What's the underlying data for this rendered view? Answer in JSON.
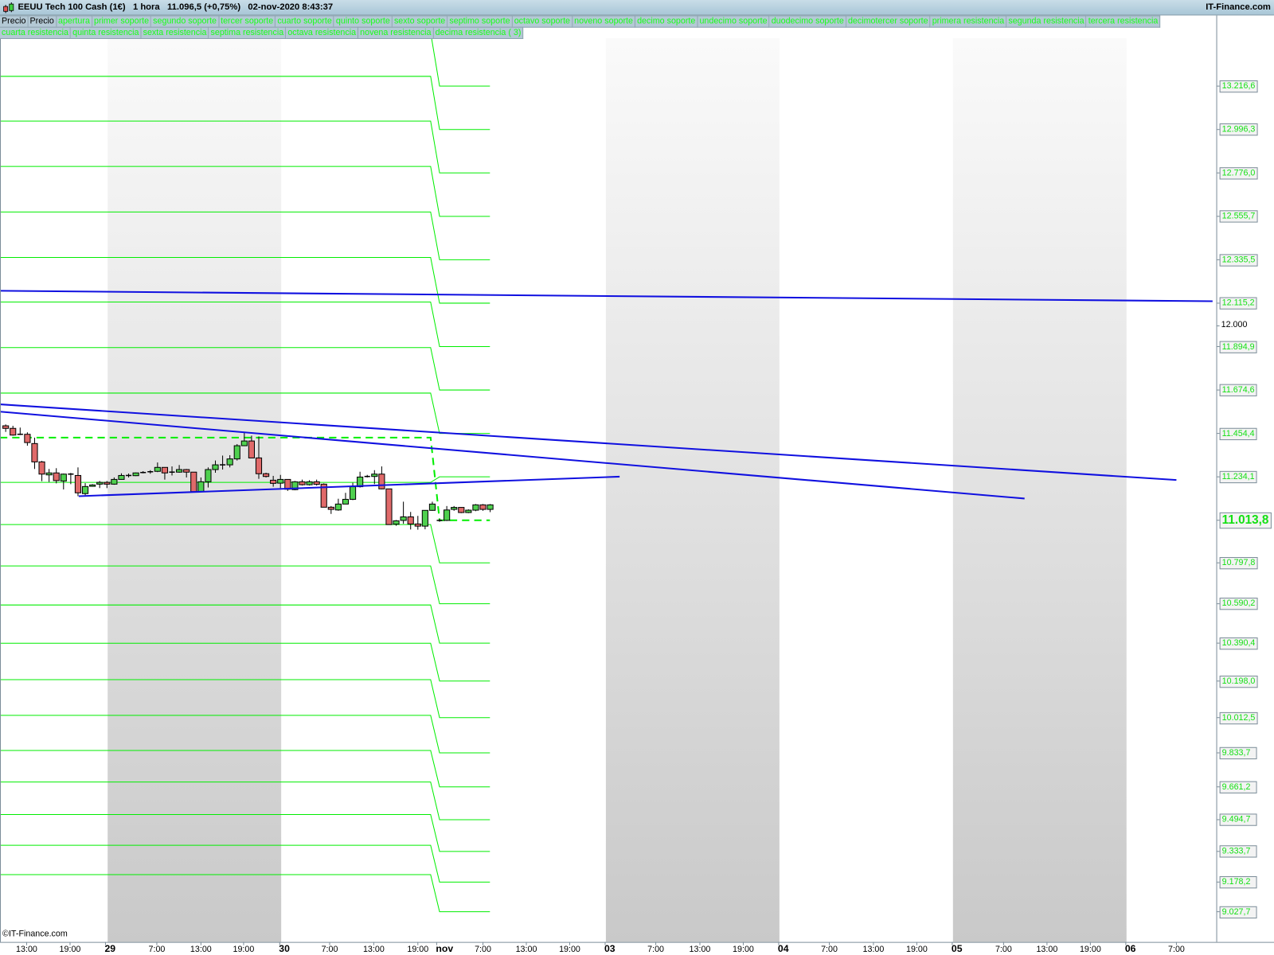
{
  "window": {
    "title": "EEUU Tech 100 Cash (1€)   1 hora   11.096,5 (+0,75%)   02-nov-2020 8:43:37",
    "brand": "IT-Finance.com",
    "copyright": "©IT-Finance.com"
  },
  "legend": {
    "row1": [
      "Precio",
      "Precio",
      "apertura",
      "primer soporte",
      "segundo soporte",
      "tercer soporte",
      "cuarto soporte",
      "quinto soporte",
      "sexto soporte",
      "septimo soporte",
      "octavo soporte",
      "noveno soporte",
      "decimo soporte",
      "undecimo soporte",
      "duodecimo soporte",
      "decimotercer soporte",
      "primera resistencia",
      "segunda resistencia",
      "tercera resistencia"
    ],
    "row2": [
      "cuarta resistencia",
      "quinta resistencia",
      "sexta resistencia",
      "septima resistencia",
      "octava resistencia",
      "novena resistencia",
      "decima resistencia ( 3)"
    ]
  },
  "colors": {
    "up": "#4fd04f",
    "down": "#e06a6a",
    "level": "#00ee00",
    "trend": "#1010e0",
    "label_text": "#14e014"
  },
  "chart_data": {
    "type": "candlestick",
    "symbol": "EEUU Tech 100 Cash (1€)",
    "interval": "1 hora",
    "ylim": [
      8980,
      13500
    ],
    "candles": [
      [
        11493,
        11500,
        11462,
        11480
      ],
      [
        11480,
        11493,
        11443,
        11446
      ],
      [
        11450,
        11484,
        11446,
        11449
      ],
      [
        11450,
        11460,
        11392,
        11408
      ],
      [
        11403,
        11433,
        11274,
        11310
      ],
      [
        11310,
        11315,
        11212,
        11248
      ],
      [
        11244,
        11274,
        11208,
        11254
      ],
      [
        11254,
        11278,
        11201,
        11215
      ],
      [
        11213,
        11251,
        11170,
        11248
      ],
      [
        11248,
        11254,
        11197,
        11247
      ],
      [
        11241,
        11282,
        11136,
        11153
      ],
      [
        11149,
        11202,
        11141,
        11185
      ],
      [
        11186,
        11197,
        11184,
        11193
      ],
      [
        11197,
        11213,
        11177,
        11206
      ],
      [
        11206,
        11213,
        11177,
        11197
      ],
      [
        11197,
        11231,
        11194,
        11221
      ],
      [
        11221,
        11252,
        11220,
        11241
      ],
      [
        11241,
        11251,
        11231,
        11240
      ],
      [
        11240,
        11256,
        11238,
        11254
      ],
      [
        11256,
        11263,
        11252,
        11255
      ],
      [
        11260,
        11268,
        11250,
        11259
      ],
      [
        11262,
        11307,
        11258,
        11282
      ],
      [
        11282,
        11282,
        11220,
        11254
      ],
      [
        11258,
        11287,
        11241,
        11257
      ],
      [
        11258,
        11294,
        11255,
        11271
      ],
      [
        11271,
        11274,
        11231,
        11258
      ],
      [
        11258,
        11258,
        11159,
        11159
      ],
      [
        11159,
        11231,
        11159,
        11209
      ],
      [
        11209,
        11282,
        11180,
        11271
      ],
      [
        11271,
        11317,
        11255,
        11295
      ],
      [
        11295,
        11342,
        11271,
        11294
      ],
      [
        11295,
        11344,
        11282,
        11325
      ],
      [
        11325,
        11400,
        11317,
        11392
      ],
      [
        11392,
        11460,
        11390,
        11416
      ],
      [
        11416,
        11443,
        11330,
        11330
      ],
      [
        11330,
        11439,
        11224,
        11250
      ],
      [
        11250,
        11255,
        11231,
        11236
      ],
      [
        11217,
        11239,
        11184,
        11201
      ],
      [
        11202,
        11244,
        11177,
        11221
      ],
      [
        11221,
        11221,
        11163,
        11171
      ],
      [
        11169,
        11213,
        11166,
        11209
      ],
      [
        11209,
        11220,
        11190,
        11194
      ],
      [
        11194,
        11217,
        11190,
        11209
      ],
      [
        11209,
        11220,
        11190,
        11196
      ],
      [
        11197,
        11201,
        11080,
        11080
      ],
      [
        11080,
        11086,
        11046,
        11069
      ],
      [
        11066,
        11123,
        11062,
        11096
      ],
      [
        11096,
        11153,
        11096,
        11120
      ],
      [
        11120,
        11204,
        11116,
        11184
      ],
      [
        11184,
        11260,
        11180,
        11233
      ],
      [
        11236,
        11244,
        11231,
        11235
      ],
      [
        11236,
        11268,
        11197,
        11248
      ],
      [
        11248,
        11287,
        11171,
        11173
      ],
      [
        11173,
        11173,
        10991,
        10992
      ],
      [
        10994,
        11015,
        10986,
        11011
      ],
      [
        11013,
        11108,
        10996,
        11031
      ],
      [
        11031,
        11056,
        10967,
        10995
      ],
      [
        10995,
        11036,
        10966,
        10984
      ],
      [
        10984,
        11064,
        10968,
        11064
      ],
      [
        11064,
        11108,
        11062,
        11096
      ],
      [
        11013,
        11020,
        11006,
        11012
      ],
      [
        11013,
        11086,
        11010,
        11066
      ],
      [
        11069,
        11086,
        11062,
        11079
      ],
      [
        11079,
        11080,
        11050,
        11053
      ],
      [
        11053,
        11069,
        11050,
        11065
      ],
      [
        11065,
        11096,
        11060,
        11092
      ],
      [
        11092,
        11096,
        11062,
        11069
      ],
      [
        11069,
        11096,
        11055,
        11092
      ]
    ],
    "levels_previous": [
      13488,
      13266,
      13039,
      12809,
      12578,
      12347,
      12121,
      11890,
      11659,
      11206,
      10992,
      10782,
      10584,
      10390,
      10205,
      10024,
      9846,
      9686,
      9521,
      9365,
      9216
    ],
    "levels_current": [
      13216.6,
      12996.3,
      12776.0,
      12555.7,
      12335.5,
      12115.2,
      11894.9,
      11674.6,
      11454.4,
      11234.1,
      10797.8,
      10590.2,
      10390.4,
      10198.0,
      10012.5,
      9833.7,
      9661.2,
      9494.7,
      9333.7,
      9178.2,
      9027.7
    ],
    "apertura_previous": 11433,
    "apertura_current": 11013.8,
    "trendlines": [
      {
        "from": {
          "bar": -0.8,
          "price": 12178
        },
        "to": {
          "bar": 166.9,
          "price": 12125
        }
      },
      {
        "from": {
          "bar": -0.8,
          "price": 11602
        },
        "to": {
          "bar": 161.9,
          "price": 11218
        }
      },
      {
        "from": {
          "bar": -0.8,
          "price": 11565
        },
        "to": {
          "bar": 140.9,
          "price": 11124
        }
      },
      {
        "from": {
          "bar": 10.1,
          "price": 11136
        },
        "to": {
          "bar": 84.9,
          "price": 11235
        }
      }
    ],
    "shaded_ranges": [
      [
        14.1,
        38.1
      ],
      [
        83,
        107
      ],
      [
        131,
        155
      ]
    ],
    "y_ticks": [
      {
        "value": 13216.6,
        "label": "13.216,6",
        "style": "box"
      },
      {
        "value": 12996.3,
        "label": "12.996,3",
        "style": "box"
      },
      {
        "value": 12776.0,
        "label": "12.776,0",
        "style": "box"
      },
      {
        "value": 12555.7,
        "label": "12.555,7",
        "style": "box"
      },
      {
        "value": 12335.5,
        "label": "12.335,5",
        "style": "box"
      },
      {
        "value": 12115.2,
        "label": "12.115,2",
        "style": "box"
      },
      {
        "value": 12000,
        "label": "12.000",
        "style": "plain"
      },
      {
        "value": 11894.9,
        "label": "11.894,9",
        "style": "box"
      },
      {
        "value": 11674.6,
        "label": "11.674,6",
        "style": "box"
      },
      {
        "value": 11454.4,
        "label": "11.454,4",
        "style": "box"
      },
      {
        "value": 11234.1,
        "label": "11.234,1",
        "style": "box"
      },
      {
        "value": 11013.8,
        "label": "11.013,8",
        "style": "big"
      },
      {
        "value": 10797.8,
        "label": "10.797,8",
        "style": "box"
      },
      {
        "value": 10590.2,
        "label": "10.590,2",
        "style": "box"
      },
      {
        "value": 10390.4,
        "label": "10.390,4",
        "style": "box"
      },
      {
        "value": 10198.0,
        "label": "10.198,0",
        "style": "box"
      },
      {
        "value": 10012.5,
        "label": "10.012,5",
        "style": "box"
      },
      {
        "value": 9833.7,
        "label": "9.833,7",
        "style": "box"
      },
      {
        "value": 9661.2,
        "label": "9.661,2",
        "style": "box"
      },
      {
        "value": 9494.7,
        "label": "9.494,7",
        "style": "box"
      },
      {
        "value": 9333.7,
        "label": "9.333,7",
        "style": "box"
      },
      {
        "value": 9178.2,
        "label": "9.178,2",
        "style": "box"
      },
      {
        "value": 9027.7,
        "label": "9.027,7",
        "style": "box"
      }
    ],
    "x_ticks": [
      {
        "label": "13:00",
        "bar": 2.9
      },
      {
        "label": "19:00",
        "bar": 8.9
      },
      {
        "label": "29",
        "bar": 13.8,
        "day": true
      },
      {
        "label": "7:00",
        "bar": 20.9
      },
      {
        "label": "13:00",
        "bar": 27
      },
      {
        "label": "19:00",
        "bar": 32.9
      },
      {
        "label": "30",
        "bar": 37.9,
        "day": true
      },
      {
        "label": "7:00",
        "bar": 44.8
      },
      {
        "label": "13:00",
        "bar": 50.9
      },
      {
        "label": "19:00",
        "bar": 57
      },
      {
        "label": "nov",
        "bar": 59.6,
        "day": true
      },
      {
        "label": "7:00",
        "bar": 66
      },
      {
        "label": "13:00",
        "bar": 72
      },
      {
        "label": "19:00",
        "bar": 78
      },
      {
        "label": "03",
        "bar": 82.9,
        "day": true
      },
      {
        "label": "7:00",
        "bar": 89.9
      },
      {
        "label": "13:00",
        "bar": 96
      },
      {
        "label": "19:00",
        "bar": 102
      },
      {
        "label": "04",
        "bar": 106.9,
        "day": true
      },
      {
        "label": "7:00",
        "bar": 113.9
      },
      {
        "label": "13:00",
        "bar": 120
      },
      {
        "label": "19:00",
        "bar": 126
      },
      {
        "label": "05",
        "bar": 130.9,
        "day": true
      },
      {
        "label": "7:00",
        "bar": 138
      },
      {
        "label": "13:00",
        "bar": 144
      },
      {
        "label": "19:00",
        "bar": 150
      },
      {
        "label": "06",
        "bar": 154.9,
        "day": true
      },
      {
        "label": "7:00",
        "bar": 161.9
      }
    ]
  }
}
